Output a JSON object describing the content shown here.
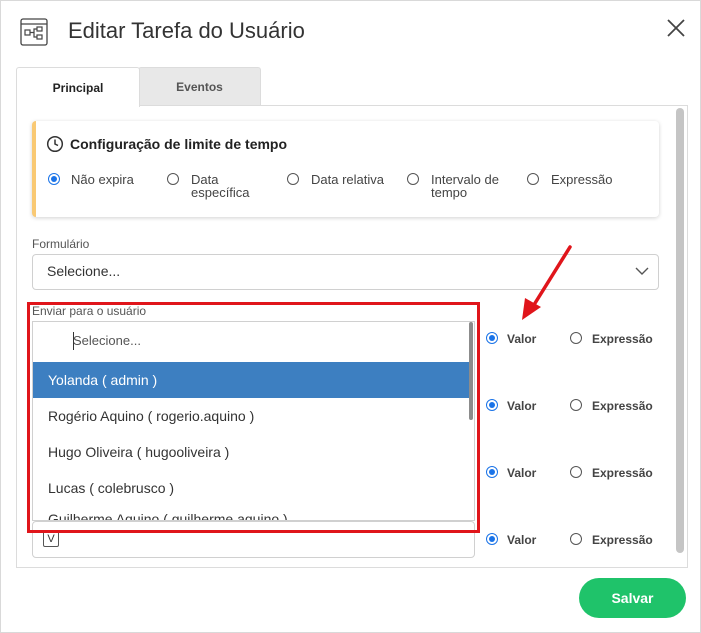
{
  "dialog": {
    "title": "Editar Tarefa do Usuário"
  },
  "tabs": [
    {
      "label": "Principal"
    },
    {
      "label": "Eventos"
    }
  ],
  "time_limit": {
    "title": "Configuração de limite de tempo",
    "options": [
      {
        "line1": "Não expira",
        "line2": ""
      },
      {
        "line1": "Data",
        "line2": "específica"
      },
      {
        "line1": "Data relativa",
        "line2": ""
      },
      {
        "line1": "Intervalo de",
        "line2": "tempo"
      },
      {
        "line1": "Expressão",
        "line2": ""
      }
    ],
    "selected": "Não expira"
  },
  "form_field": {
    "label": "Formulário",
    "value": "Selecione..."
  },
  "send_to": {
    "label": "Enviar para o usuário",
    "search_placeholder": "Selecione...",
    "options": [
      "Yolanda ( admin )",
      "Rogério Aquino ( rogerio.aquino )",
      "Hugo Oliveira ( hugooliveira )",
      "Lucas ( colebrusco )",
      "Guilherme Aquino ( guilherme.aquino )"
    ],
    "highlighted": "Yolanda ( admin )"
  },
  "value_mode_rows": [
    {
      "valor": "Valor",
      "expressao": "Expressão",
      "selected": "Valor"
    },
    {
      "valor": "Valor",
      "expressao": "Expressão",
      "selected": "Valor"
    },
    {
      "valor": "Valor",
      "expressao": "Expressão",
      "selected": "Valor"
    },
    {
      "valor": "Valor",
      "expressao": "Expressão",
      "selected": "Valor"
    }
  ],
  "input_badge": "V",
  "footer": {
    "save_label": "Salvar"
  },
  "colors": {
    "accent": "#1a73e8",
    "save": "#1fc36a",
    "highlight": "#3d7fc1",
    "annotation": "#e0151b",
    "card_border": "#f9c974"
  }
}
